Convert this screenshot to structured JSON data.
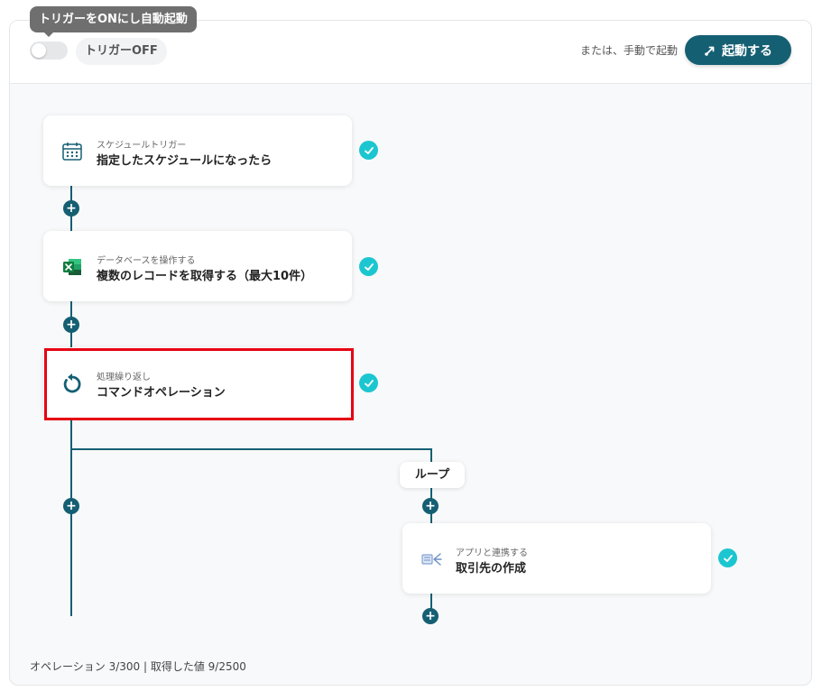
{
  "header": {
    "tooltip": "トリガーをONにし自動起動",
    "trigger_label": "トリガーOFF",
    "manual_text": "または、手動で起動",
    "start_button": "起動する"
  },
  "flow": {
    "steps": [
      {
        "type": "スケジュールトリガー",
        "title": "指定したスケジュールになったら",
        "icon": "calendar-icon",
        "status": "done"
      },
      {
        "type": "データベースを操作する",
        "title": "複数のレコードを取得する（最大10件）",
        "icon": "excel-icon",
        "status": "done"
      },
      {
        "type": "処理繰り返し",
        "title": "コマンドオペレーション",
        "icon": "loop-icon",
        "status": "done",
        "highlighted": true
      },
      {
        "type": "アプリと連携する",
        "title": "取引先の作成",
        "icon": "app-icon",
        "status": "done"
      }
    ],
    "loop_label": "ループ"
  },
  "footer": {
    "usage": "オペレーション 3/300 | 取得した値 9/2500"
  },
  "colors": {
    "primary": "#155f73",
    "check": "#1cc6d0",
    "highlight": "#e60012",
    "excel": "#1d6f42"
  }
}
